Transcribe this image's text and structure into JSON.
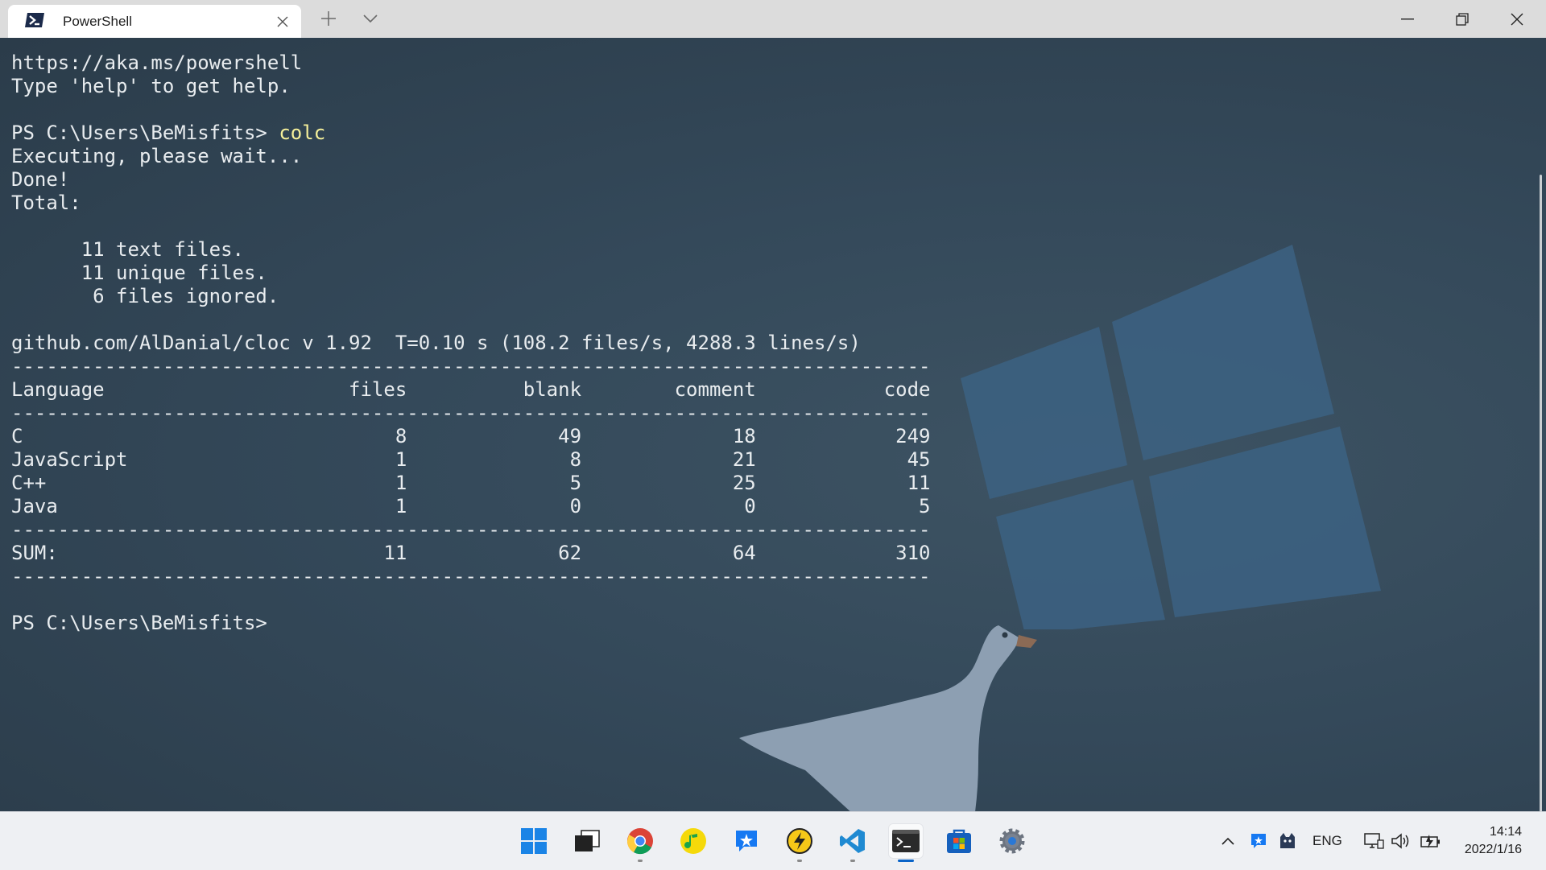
{
  "window": {
    "tab_title": "PowerShell"
  },
  "terminal": {
    "lines": [
      {
        "prompt": "",
        "text": "https://aka.ms/powershell"
      },
      {
        "prompt": "",
        "text": "Type 'help' to get help."
      },
      {
        "prompt": "",
        "text": ""
      },
      {
        "prompt": "PS C:\\Users\\BeMisfits> ",
        "text": "colc"
      },
      {
        "prompt": "",
        "text": "Executing, please wait..."
      },
      {
        "prompt": "",
        "text": "Done!"
      },
      {
        "prompt": "",
        "text": "Total:"
      },
      {
        "prompt": "",
        "text": ""
      },
      {
        "prompt": "",
        "text": "      11 text files."
      },
      {
        "prompt": "",
        "text": "      11 unique files."
      },
      {
        "prompt": "",
        "text": "       6 files ignored."
      },
      {
        "prompt": "",
        "text": ""
      },
      {
        "prompt": "",
        "text": "github.com/AlDanial/cloc v 1.92  T=0.10 s (108.2 files/s, 4288.3 lines/s)"
      },
      {
        "prompt": "",
        "text": "-------------------------------------------------------------------------------"
      },
      {
        "prompt": "",
        "text": "Language                     files          blank        comment           code"
      },
      {
        "prompt": "",
        "text": "-------------------------------------------------------------------------------"
      },
      {
        "prompt": "",
        "text": "C                                8             49             18            249"
      },
      {
        "prompt": "",
        "text": "JavaScript                       1              8             21             45"
      },
      {
        "prompt": "",
        "text": "C++                              1              5             25             11"
      },
      {
        "prompt": "",
        "text": "Java                             1              0              0              5"
      },
      {
        "prompt": "",
        "text": "-------------------------------------------------------------------------------"
      },
      {
        "prompt": "",
        "text": "SUM:                            11             62             64            310"
      },
      {
        "prompt": "",
        "text": "-------------------------------------------------------------------------------"
      },
      {
        "prompt": "",
        "text": ""
      },
      {
        "prompt": "PS C:\\Users\\BeMisfits>",
        "text": ""
      }
    ]
  },
  "taskbar": {
    "apps": [
      "start-icon",
      "task-view-icon",
      "chrome-icon",
      "music-app-icon",
      "chat-app-icon",
      "lightning-app-icon",
      "vscode-icon",
      "terminal-icon",
      "store-icon",
      "settings-icon"
    ],
    "tray": {
      "language": "ENG",
      "time": "14:14",
      "date": "2022/1/16"
    }
  },
  "colors": {
    "terminal_bg": "#2f4250",
    "command_text": "#f5f09a",
    "output_text": "#e8ecef",
    "titlebar_bg": "#dcdcdc",
    "taskbar_bg": "#eef0f3"
  }
}
